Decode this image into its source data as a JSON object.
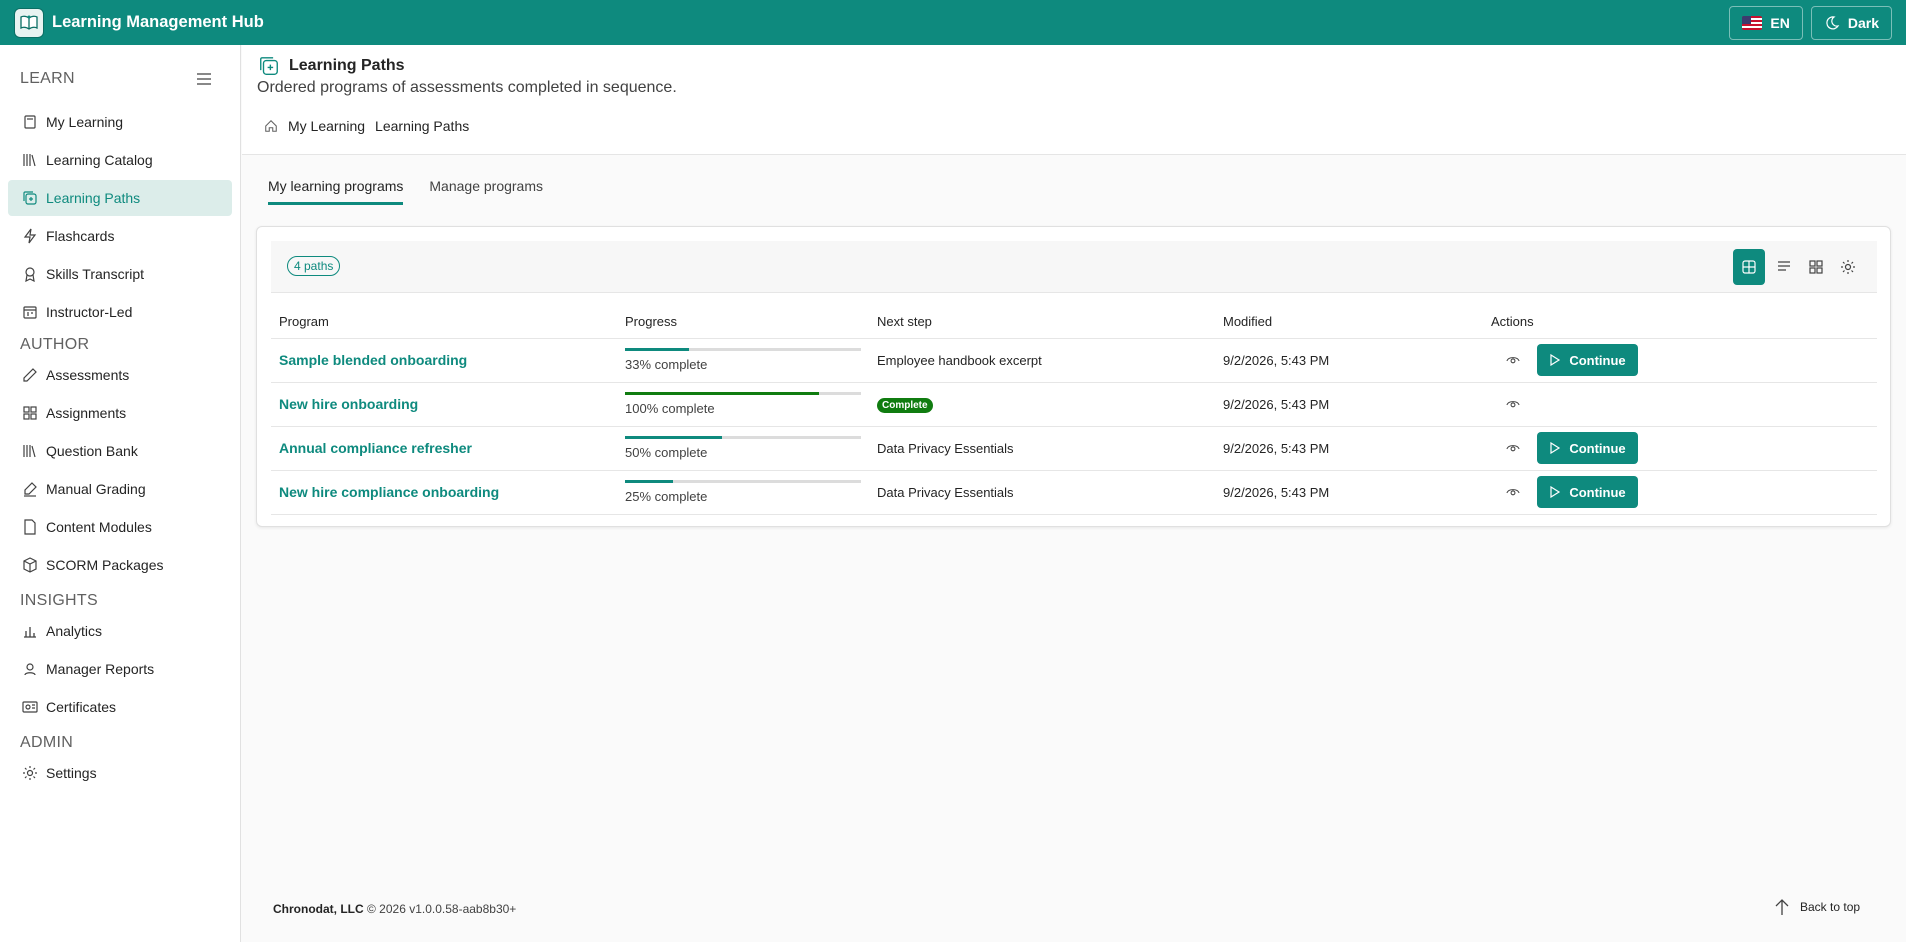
{
  "app": {
    "title": "Learning Management Hub"
  },
  "topbar": {
    "language_label": "EN",
    "theme_label": "Dark"
  },
  "sidebar": {
    "sections": [
      {
        "heading": "LEARN",
        "items": [
          {
            "label": "My Learning",
            "icon": "book-icon"
          },
          {
            "label": "Learning Catalog",
            "icon": "library-icon"
          },
          {
            "label": "Learning Paths",
            "icon": "path-icon",
            "active": true
          },
          {
            "label": "Flashcards",
            "icon": "flash-icon"
          },
          {
            "label": "Skills Transcript",
            "icon": "ribbon-icon"
          },
          {
            "label": "Instructor-Led",
            "icon": "calendar-icon"
          }
        ]
      },
      {
        "heading": "AUTHOR",
        "items": [
          {
            "label": "Assessments",
            "icon": "pencil-icon"
          },
          {
            "label": "Assignments",
            "icon": "grid-icon"
          },
          {
            "label": "Question Bank",
            "icon": "library-icon"
          },
          {
            "label": "Manual Grading",
            "icon": "grading-icon"
          },
          {
            "label": "Content Modules",
            "icon": "document-icon"
          },
          {
            "label": "SCORM Packages",
            "icon": "package-icon"
          }
        ]
      },
      {
        "heading": "INSIGHTS",
        "items": [
          {
            "label": "Analytics",
            "icon": "chart-icon"
          },
          {
            "label": "Manager Reports",
            "icon": "people-icon"
          },
          {
            "label": "Certificates",
            "icon": "certificate-icon"
          }
        ]
      },
      {
        "heading": "ADMIN",
        "items": [
          {
            "label": "Settings",
            "icon": "gear-icon"
          }
        ]
      }
    ]
  },
  "page": {
    "title": "Learning Paths",
    "subtitle": "Ordered programs of assessments completed in sequence.",
    "breadcrumb": [
      "My Learning",
      "Learning Paths"
    ]
  },
  "tabs": [
    {
      "label": "My learning programs",
      "active": true
    },
    {
      "label": "Manage programs"
    }
  ],
  "toolbar": {
    "count_label": "4 paths"
  },
  "table": {
    "columns": [
      "Program",
      "Progress",
      "Next step",
      "Modified",
      "Actions"
    ],
    "rows": [
      {
        "program": "Sample blended onboarding",
        "progress": 33,
        "progress_label": "33% complete",
        "next_step": "Employee handbook excerpt",
        "modified": "9/2/2026, 5:43 PM",
        "action": "Continue"
      },
      {
        "program": "New hire onboarding",
        "progress": 100,
        "progress_label": "100% complete",
        "next_step": "",
        "badge": "Complete",
        "modified": "9/2/2026, 5:43 PM",
        "action": ""
      },
      {
        "program": "Annual compliance refresher",
        "progress": 50,
        "progress_label": "50% complete",
        "next_step": "Data Privacy Essentials",
        "modified": "9/2/2026, 5:43 PM",
        "action": "Continue"
      },
      {
        "program": "New hire compliance onboarding",
        "progress": 25,
        "progress_label": "25% complete",
        "next_step": "Data Privacy Essentials",
        "modified": "9/2/2026, 5:43 PM",
        "action": "Continue"
      }
    ]
  },
  "footer": {
    "company": "Chronodat, LLC",
    "copyright": "© 2026",
    "version": "v1.0.0.58-aab8b30+",
    "back_to_top": "Back to top"
  },
  "colors": {
    "brand": "#0e8a7e",
    "complete": "#107c10"
  }
}
